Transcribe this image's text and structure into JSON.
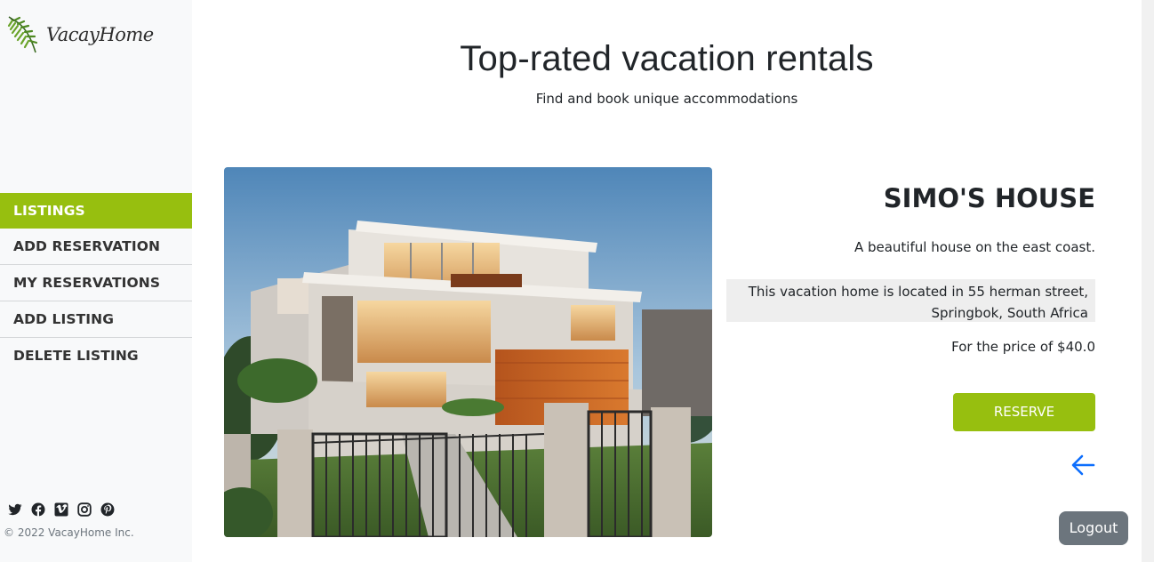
{
  "brand": {
    "name": "VacayHome",
    "logo_text": "VacayHome"
  },
  "sidebar": {
    "nav": [
      {
        "label": "LISTINGS",
        "active": true
      },
      {
        "label": "ADD RESERVATION",
        "active": false
      },
      {
        "label": "MY RESERVATIONS",
        "active": false
      },
      {
        "label": "ADD LISTING",
        "active": false
      },
      {
        "label": "DELETE LISTING",
        "active": false
      }
    ],
    "social_icons": [
      "twitter-icon",
      "facebook-icon",
      "vimeo-icon",
      "instagram-icon",
      "pinterest-icon"
    ],
    "copyright": "© 2022 VacayHome Inc."
  },
  "header": {
    "title": "Top-rated vacation rentals",
    "subtitle": "Find and book unique accommodations"
  },
  "listing": {
    "name": "SIMO'S HOUSE",
    "description": "A beautiful house on the east coast.",
    "location_line1": "This vacation home is located in 55 herman street,",
    "location_line2": "Springbok,  South Africa",
    "price_text": "For the price of $40.0",
    "reserve_label": "RESERVE",
    "back_icon": "arrow-left-icon"
  },
  "logout_label": "Logout",
  "colors": {
    "accent": "#97bf0f",
    "sidebar_bg": "#f8f9fa",
    "logout_bg": "#6c757d",
    "back_arrow": "#0d6efd",
    "location_bg": "#eeeeee"
  }
}
